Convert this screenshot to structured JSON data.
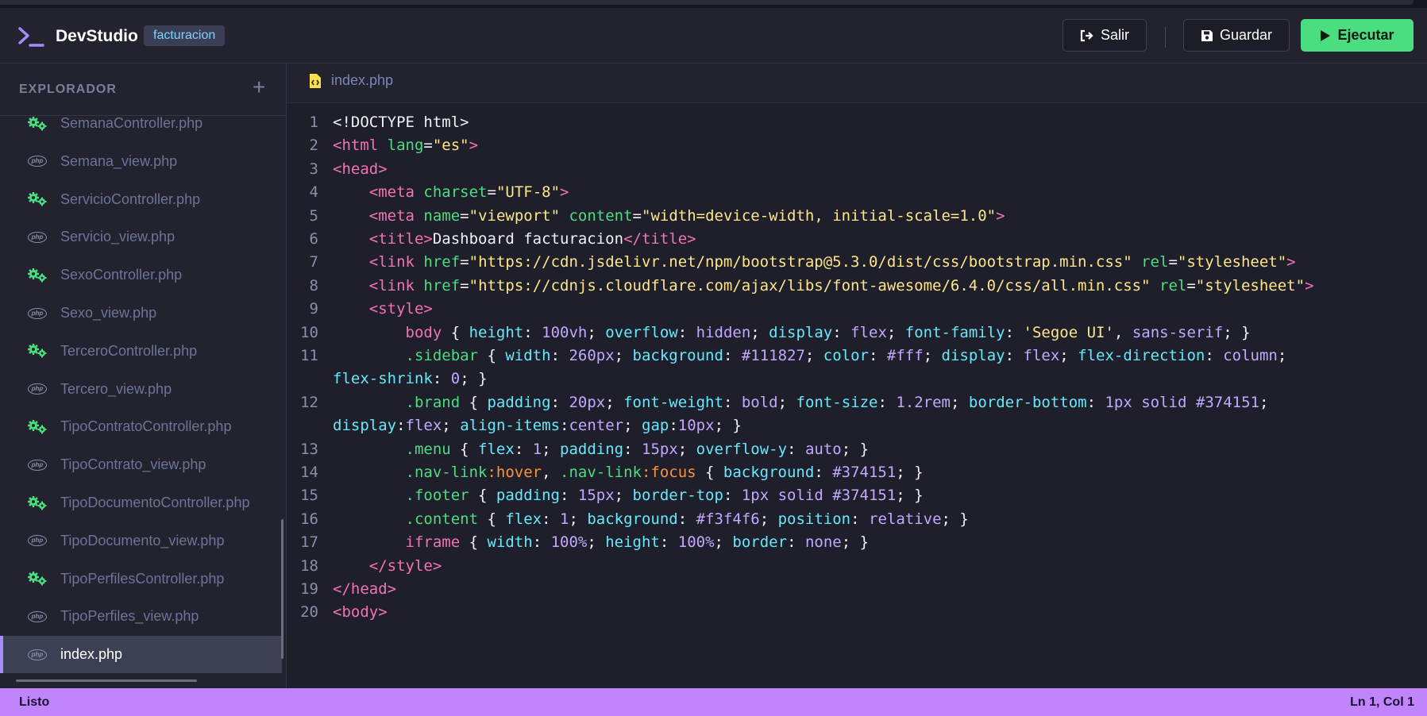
{
  "app": {
    "name": "DevStudio",
    "project": "facturacion"
  },
  "toolbar": {
    "salir_label": "Salir",
    "guardar_label": "Guardar",
    "ejecutar_label": "Ejecutar"
  },
  "sidebar": {
    "title": "EXPLORADOR",
    "add_label": "+",
    "files": [
      {
        "name": "SemanaController.php",
        "kind": "controller"
      },
      {
        "name": "Semana_view.php",
        "kind": "php"
      },
      {
        "name": "ServicioController.php",
        "kind": "controller"
      },
      {
        "name": "Servicio_view.php",
        "kind": "php"
      },
      {
        "name": "SexoController.php",
        "kind": "controller"
      },
      {
        "name": "Sexo_view.php",
        "kind": "php"
      },
      {
        "name": "TerceroController.php",
        "kind": "controller"
      },
      {
        "name": "Tercero_view.php",
        "kind": "php"
      },
      {
        "name": "TipoContratoController.php",
        "kind": "controller"
      },
      {
        "name": "TipoContrato_view.php",
        "kind": "php"
      },
      {
        "name": "TipoDocumentoController.php",
        "kind": "controller"
      },
      {
        "name": "TipoDocumento_view.php",
        "kind": "php"
      },
      {
        "name": "TipoPerfilesController.php",
        "kind": "controller"
      },
      {
        "name": "TipoPerfiles_view.php",
        "kind": "php"
      },
      {
        "name": "index.php",
        "kind": "php",
        "active": true
      }
    ]
  },
  "editor": {
    "tab_label": "index.php",
    "lines": [
      {
        "n": "1",
        "tokens": [
          [
            "t-txt",
            "<!DOCTYPE html>"
          ]
        ]
      },
      {
        "n": "2",
        "tokens": [
          [
            "t-tag",
            "<html "
          ],
          [
            "t-attr",
            "lang"
          ],
          [
            "t-txt",
            "="
          ],
          [
            "t-str",
            "\"es\""
          ],
          [
            "t-tag",
            ">"
          ]
        ]
      },
      {
        "n": "3",
        "tokens": [
          [
            "t-tag",
            "<head>"
          ]
        ]
      },
      {
        "n": "4",
        "tokens": [
          [
            "t-txt",
            "    "
          ],
          [
            "t-tag",
            "<meta "
          ],
          [
            "t-attr",
            "charset"
          ],
          [
            "t-txt",
            "="
          ],
          [
            "t-str",
            "\"UTF-8\""
          ],
          [
            "t-tag",
            ">"
          ]
        ]
      },
      {
        "n": "5",
        "tokens": [
          [
            "t-txt",
            "    "
          ],
          [
            "t-tag",
            "<meta "
          ],
          [
            "t-attr",
            "name"
          ],
          [
            "t-txt",
            "="
          ],
          [
            "t-str",
            "\"viewport\" "
          ],
          [
            "t-attr",
            "content"
          ],
          [
            "t-txt",
            "="
          ],
          [
            "t-str",
            "\"width=device-width, initial-scale=1.0\""
          ],
          [
            "t-tag",
            ">"
          ]
        ]
      },
      {
        "n": "6",
        "tokens": [
          [
            "t-txt",
            "    "
          ],
          [
            "t-tag",
            "<title>"
          ],
          [
            "t-txt",
            "Dashboard facturacion"
          ],
          [
            "t-tag",
            "</title>"
          ]
        ]
      },
      {
        "n": "7",
        "tokens": [
          [
            "t-txt",
            "    "
          ],
          [
            "t-tag",
            "<link "
          ],
          [
            "t-attr",
            "href"
          ],
          [
            "t-txt",
            "="
          ],
          [
            "t-str",
            "\"https://cdn.jsdelivr.net/npm/bootstrap@5.3.0/dist/css/bootstrap.min.css\" "
          ],
          [
            "t-attr",
            "rel"
          ],
          [
            "t-txt",
            "="
          ],
          [
            "t-str",
            "\"stylesheet\""
          ],
          [
            "t-tag",
            ">"
          ]
        ]
      },
      {
        "n": "8",
        "tokens": [
          [
            "t-txt",
            "    "
          ],
          [
            "t-tag",
            "<link "
          ],
          [
            "t-attr",
            "href"
          ],
          [
            "t-txt",
            "="
          ],
          [
            "t-str",
            "\"https://cdnjs.cloudflare.com/ajax/libs/font-awesome/6.4.0/css/all.min.css\" "
          ],
          [
            "t-attr",
            "rel"
          ],
          [
            "t-txt",
            "="
          ],
          [
            "t-str",
            "\"stylesheet\""
          ],
          [
            "t-tag",
            ">"
          ]
        ]
      },
      {
        "n": "9",
        "tokens": [
          [
            "t-txt",
            "    "
          ],
          [
            "t-tag",
            "<style>"
          ]
        ]
      },
      {
        "n": "10",
        "tokens": [
          [
            "t-txt",
            "        "
          ],
          [
            "t-sel",
            "body"
          ],
          [
            "t-txt",
            " { "
          ],
          [
            "t-prop",
            "height"
          ],
          [
            "t-txt",
            ": "
          ],
          [
            "t-val",
            "100vh"
          ],
          [
            "t-txt",
            "; "
          ],
          [
            "t-prop",
            "overflow"
          ],
          [
            "t-txt",
            ": "
          ],
          [
            "t-val",
            "hidden"
          ],
          [
            "t-txt",
            "; "
          ],
          [
            "t-prop",
            "display"
          ],
          [
            "t-txt",
            ": "
          ],
          [
            "t-val",
            "flex"
          ],
          [
            "t-txt",
            "; "
          ],
          [
            "t-prop",
            "font-family"
          ],
          [
            "t-txt",
            ": "
          ],
          [
            "t-str",
            "'Segoe UI'"
          ],
          [
            "t-txt",
            ", "
          ],
          [
            "t-val",
            "sans-serif"
          ],
          [
            "t-txt",
            "; }"
          ]
        ]
      },
      {
        "n": "11",
        "tokens": [
          [
            "t-txt",
            "        "
          ],
          [
            "t-cls",
            ".sidebar"
          ],
          [
            "t-txt",
            " { "
          ],
          [
            "t-prop",
            "width"
          ],
          [
            "t-txt",
            ": "
          ],
          [
            "t-val",
            "260px"
          ],
          [
            "t-txt",
            "; "
          ],
          [
            "t-prop",
            "background"
          ],
          [
            "t-txt",
            ": "
          ],
          [
            "t-val",
            "#111827"
          ],
          [
            "t-txt",
            "; "
          ],
          [
            "t-prop",
            "color"
          ],
          [
            "t-txt",
            ": "
          ],
          [
            "t-val",
            "#fff"
          ],
          [
            "t-txt",
            "; "
          ],
          [
            "t-prop",
            "display"
          ],
          [
            "t-txt",
            ": "
          ],
          [
            "t-val",
            "flex"
          ],
          [
            "t-txt",
            "; "
          ],
          [
            "t-prop",
            "flex-direction"
          ],
          [
            "t-txt",
            ": "
          ],
          [
            "t-val",
            "column"
          ],
          [
            "t-txt",
            ";"
          ]
        ]
      },
      {
        "n": "",
        "tokens": [
          [
            "t-prop",
            "flex-shrink"
          ],
          [
            "t-txt",
            ": "
          ],
          [
            "t-val",
            "0"
          ],
          [
            "t-txt",
            "; }"
          ]
        ]
      },
      {
        "n": "12",
        "tokens": [
          [
            "t-txt",
            "        "
          ],
          [
            "t-cls",
            ".brand"
          ],
          [
            "t-txt",
            " { "
          ],
          [
            "t-prop",
            "padding"
          ],
          [
            "t-txt",
            ": "
          ],
          [
            "t-val",
            "20px"
          ],
          [
            "t-txt",
            "; "
          ],
          [
            "t-prop",
            "font-weight"
          ],
          [
            "t-txt",
            ": "
          ],
          [
            "t-val",
            "bold"
          ],
          [
            "t-txt",
            "; "
          ],
          [
            "t-prop",
            "font-size"
          ],
          [
            "t-txt",
            ": "
          ],
          [
            "t-val",
            "1.2rem"
          ],
          [
            "t-txt",
            "; "
          ],
          [
            "t-prop",
            "border-bottom"
          ],
          [
            "t-txt",
            ": "
          ],
          [
            "t-val",
            "1px solid #374151"
          ],
          [
            "t-txt",
            ";"
          ]
        ]
      },
      {
        "n": "",
        "tokens": [
          [
            "t-prop",
            "display"
          ],
          [
            "t-txt",
            ":"
          ],
          [
            "t-val",
            "flex"
          ],
          [
            "t-txt",
            "; "
          ],
          [
            "t-prop",
            "align-items"
          ],
          [
            "t-txt",
            ":"
          ],
          [
            "t-val",
            "center"
          ],
          [
            "t-txt",
            "; "
          ],
          [
            "t-prop",
            "gap"
          ],
          [
            "t-txt",
            ":"
          ],
          [
            "t-val",
            "10px"
          ],
          [
            "t-txt",
            "; }"
          ]
        ]
      },
      {
        "n": "13",
        "tokens": [
          [
            "t-txt",
            "        "
          ],
          [
            "t-cls",
            ".menu"
          ],
          [
            "t-txt",
            " { "
          ],
          [
            "t-prop",
            "flex"
          ],
          [
            "t-txt",
            ": "
          ],
          [
            "t-val",
            "1"
          ],
          [
            "t-txt",
            "; "
          ],
          [
            "t-prop",
            "padding"
          ],
          [
            "t-txt",
            ": "
          ],
          [
            "t-val",
            "15px"
          ],
          [
            "t-txt",
            "; "
          ],
          [
            "t-prop",
            "overflow-y"
          ],
          [
            "t-txt",
            ": "
          ],
          [
            "t-val",
            "auto"
          ],
          [
            "t-txt",
            "; }"
          ]
        ]
      },
      {
        "n": "14",
        "tokens": [
          [
            "t-txt",
            "        "
          ],
          [
            "t-cls",
            ".nav-link"
          ],
          [
            "t-pseudo",
            ":hover"
          ],
          [
            "t-txt",
            ", "
          ],
          [
            "t-cls",
            ".nav-link"
          ],
          [
            "t-pseudo",
            ":focus"
          ],
          [
            "t-txt",
            " { "
          ],
          [
            "t-prop",
            "background"
          ],
          [
            "t-txt",
            ": "
          ],
          [
            "t-val",
            "#374151"
          ],
          [
            "t-txt",
            "; }"
          ]
        ]
      },
      {
        "n": "15",
        "tokens": [
          [
            "t-txt",
            "        "
          ],
          [
            "t-cls",
            ".footer"
          ],
          [
            "t-txt",
            " { "
          ],
          [
            "t-prop",
            "padding"
          ],
          [
            "t-txt",
            ": "
          ],
          [
            "t-val",
            "15px"
          ],
          [
            "t-txt",
            "; "
          ],
          [
            "t-prop",
            "border-top"
          ],
          [
            "t-txt",
            ": "
          ],
          [
            "t-val",
            "1px solid #374151"
          ],
          [
            "t-txt",
            "; }"
          ]
        ]
      },
      {
        "n": "16",
        "tokens": [
          [
            "t-txt",
            "        "
          ],
          [
            "t-cls",
            ".content"
          ],
          [
            "t-txt",
            " { "
          ],
          [
            "t-prop",
            "flex"
          ],
          [
            "t-txt",
            ": "
          ],
          [
            "t-val",
            "1"
          ],
          [
            "t-txt",
            "; "
          ],
          [
            "t-prop",
            "background"
          ],
          [
            "t-txt",
            ": "
          ],
          [
            "t-val",
            "#f3f4f6"
          ],
          [
            "t-txt",
            "; "
          ],
          [
            "t-prop",
            "position"
          ],
          [
            "t-txt",
            ": "
          ],
          [
            "t-val",
            "relative"
          ],
          [
            "t-txt",
            "; }"
          ]
        ]
      },
      {
        "n": "17",
        "tokens": [
          [
            "t-txt",
            "        "
          ],
          [
            "t-sel",
            "iframe"
          ],
          [
            "t-txt",
            " { "
          ],
          [
            "t-prop",
            "width"
          ],
          [
            "t-txt",
            ": "
          ],
          [
            "t-val",
            "100%"
          ],
          [
            "t-txt",
            "; "
          ],
          [
            "t-prop",
            "height"
          ],
          [
            "t-txt",
            ": "
          ],
          [
            "t-val",
            "100%"
          ],
          [
            "t-txt",
            "; "
          ],
          [
            "t-prop",
            "border"
          ],
          [
            "t-txt",
            ": "
          ],
          [
            "t-val",
            "none"
          ],
          [
            "t-txt",
            "; }"
          ]
        ]
      },
      {
        "n": "18",
        "tokens": [
          [
            "t-txt",
            "    "
          ],
          [
            "t-tag",
            "</style>"
          ]
        ]
      },
      {
        "n": "19",
        "tokens": [
          [
            "t-tag",
            "</head>"
          ]
        ]
      },
      {
        "n": "20",
        "tokens": [
          [
            "t-tag",
            "<body>"
          ]
        ]
      }
    ]
  },
  "status": {
    "left": "Listo",
    "right": "Ln 1, Col 1"
  },
  "colors": {
    "accent": "#c084fc",
    "run": "#4ade80",
    "badge": "#7dd3fc"
  }
}
